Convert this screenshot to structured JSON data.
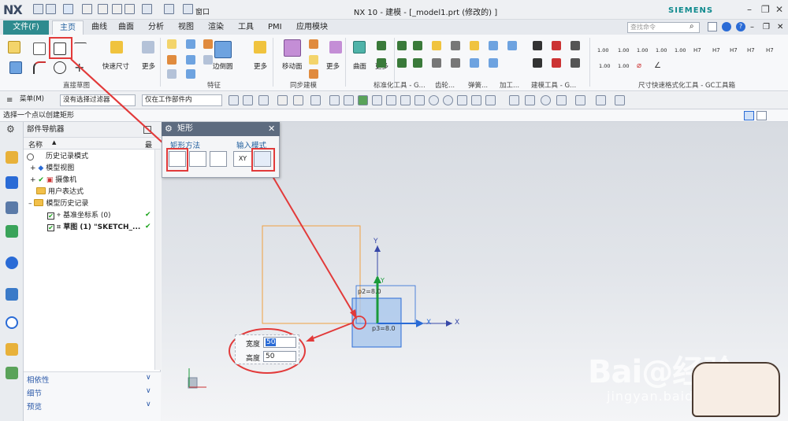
{
  "app": {
    "logo": "NX",
    "window_title": "NX 10 - 建模 - [_model1.prt  (修改的) ]",
    "brand": "SIEMENS",
    "window_dropdown": "窗口"
  },
  "tabs": [
    "文件(F)",
    "主页",
    "曲线",
    "曲面",
    "分析",
    "视图",
    "渲染",
    "工具",
    "PMI",
    "应用模块"
  ],
  "search": {
    "placeholder": "查找命令"
  },
  "ribbon": {
    "labels": {
      "quick_dim": "快速尺寸",
      "more1": "更多",
      "edge_blend": "边倒圆",
      "more2": "更多",
      "move_face": "移动面",
      "more3": "更多",
      "surface": "曲面",
      "more4": "更多"
    },
    "groups": [
      "直接草图",
      "特征",
      "同步建模",
      "标准化工具 - G...",
      "齿轮...",
      "弹簧...",
      "加工...",
      "建模工具 - G...",
      "尺寸快速格式化工具 - GC工具箱"
    ],
    "dim_values": [
      "1.00",
      "1.00",
      "1.00",
      "1.00",
      "1.00",
      "1.00",
      "1.00",
      "1.00",
      "1.00"
    ]
  },
  "toolbar": {
    "menu": "菜单(M)",
    "filter": "没有选择过滤器",
    "scope": "仅在工作部件内"
  },
  "status": "选择一个点以创建矩形",
  "navigator": {
    "title": "部件导航器",
    "col_name": "名称",
    "col_latest": "最",
    "rows": [
      {
        "label": "历史记录模式",
        "indent": 0
      },
      {
        "label": "模型视图",
        "indent": 0
      },
      {
        "label": "摄像机",
        "indent": 0
      },
      {
        "label": "用户表达式",
        "indent": 0
      },
      {
        "label": "模型历史记录",
        "indent": 0
      },
      {
        "label": "基准坐标系 (0)",
        "indent": 1
      },
      {
        "label": "草图 (1) \"SKETCH_...",
        "indent": 1
      }
    ],
    "bottom": [
      "相依性",
      "细节",
      "预览"
    ]
  },
  "dialog": {
    "title": "矩形",
    "method_label": "矩形方法",
    "input_label": "输入模式",
    "xy": "XY"
  },
  "dims": {
    "width_label": "宽度",
    "width_value": "50",
    "height_label": "高度",
    "height_value": "50"
  },
  "canvas": {
    "p2": "p2=8.0",
    "p3": "p3=8.0",
    "x_label": "X",
    "y_label": "Y",
    "x2": "X",
    "y2": "Y"
  },
  "watermark": {
    "main": "Bai@经验",
    "sub": "jingyan.baidu.com"
  }
}
